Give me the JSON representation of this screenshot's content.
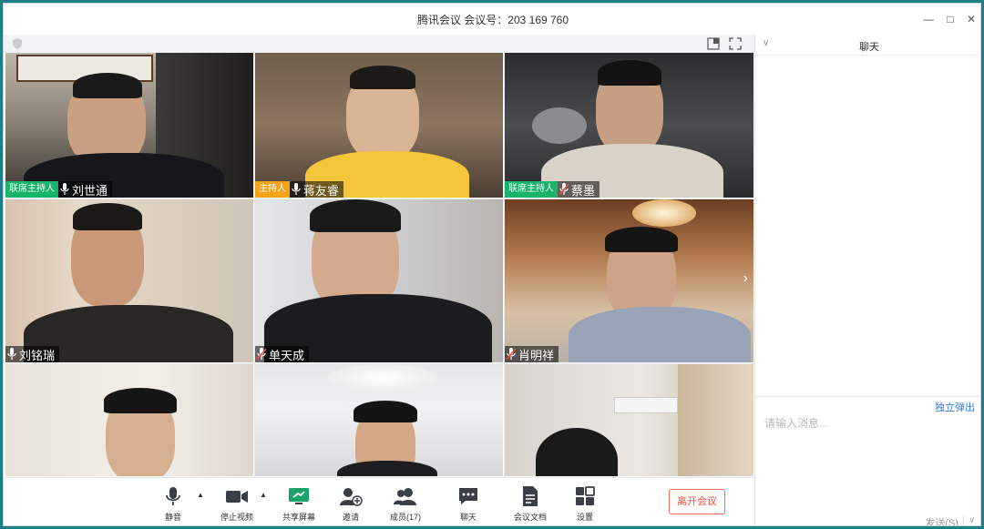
{
  "window": {
    "title": "腾讯会议 会议号：203 169 760"
  },
  "chat": {
    "title": "聊天",
    "popout_label": "独立弹出",
    "input_placeholder": "请输入消息...",
    "send_label": "发送(S)"
  },
  "participants": [
    {
      "name": "刘世通",
      "role": "联席主持人",
      "role_color": "#19b36b",
      "mic": "on"
    },
    {
      "name": "蒋友睿",
      "role": "主持人",
      "role_color": "#f3a21a",
      "mic": "on"
    },
    {
      "name": "蔡墨",
      "role": "联席主持人",
      "role_color": "#19b36b",
      "mic": "muted"
    },
    {
      "name": "刘铭瑞",
      "role": "",
      "mic": "on"
    },
    {
      "name": "单天成",
      "role": "",
      "mic": "muted"
    },
    {
      "name": "肖明祥",
      "role": "",
      "mic": "muted"
    },
    {
      "name": "",
      "role": "",
      "mic": ""
    },
    {
      "name": "",
      "role": "",
      "mic": ""
    },
    {
      "name": "",
      "role": "",
      "mic": ""
    }
  ],
  "toolbar": {
    "mute": "静音",
    "stop_video": "停止视频",
    "share_screen": "共享屏幕",
    "invite": "邀请",
    "members": "成员(17)",
    "chat": "聊天",
    "meeting_docs": "会议文档",
    "settings": "设置",
    "leave": "离开会议"
  },
  "colors": {
    "accent_green": "#19b36b",
    "host_orange": "#f3a21a",
    "leave_red": "#f0503e",
    "link_blue": "#2e7bd6"
  }
}
